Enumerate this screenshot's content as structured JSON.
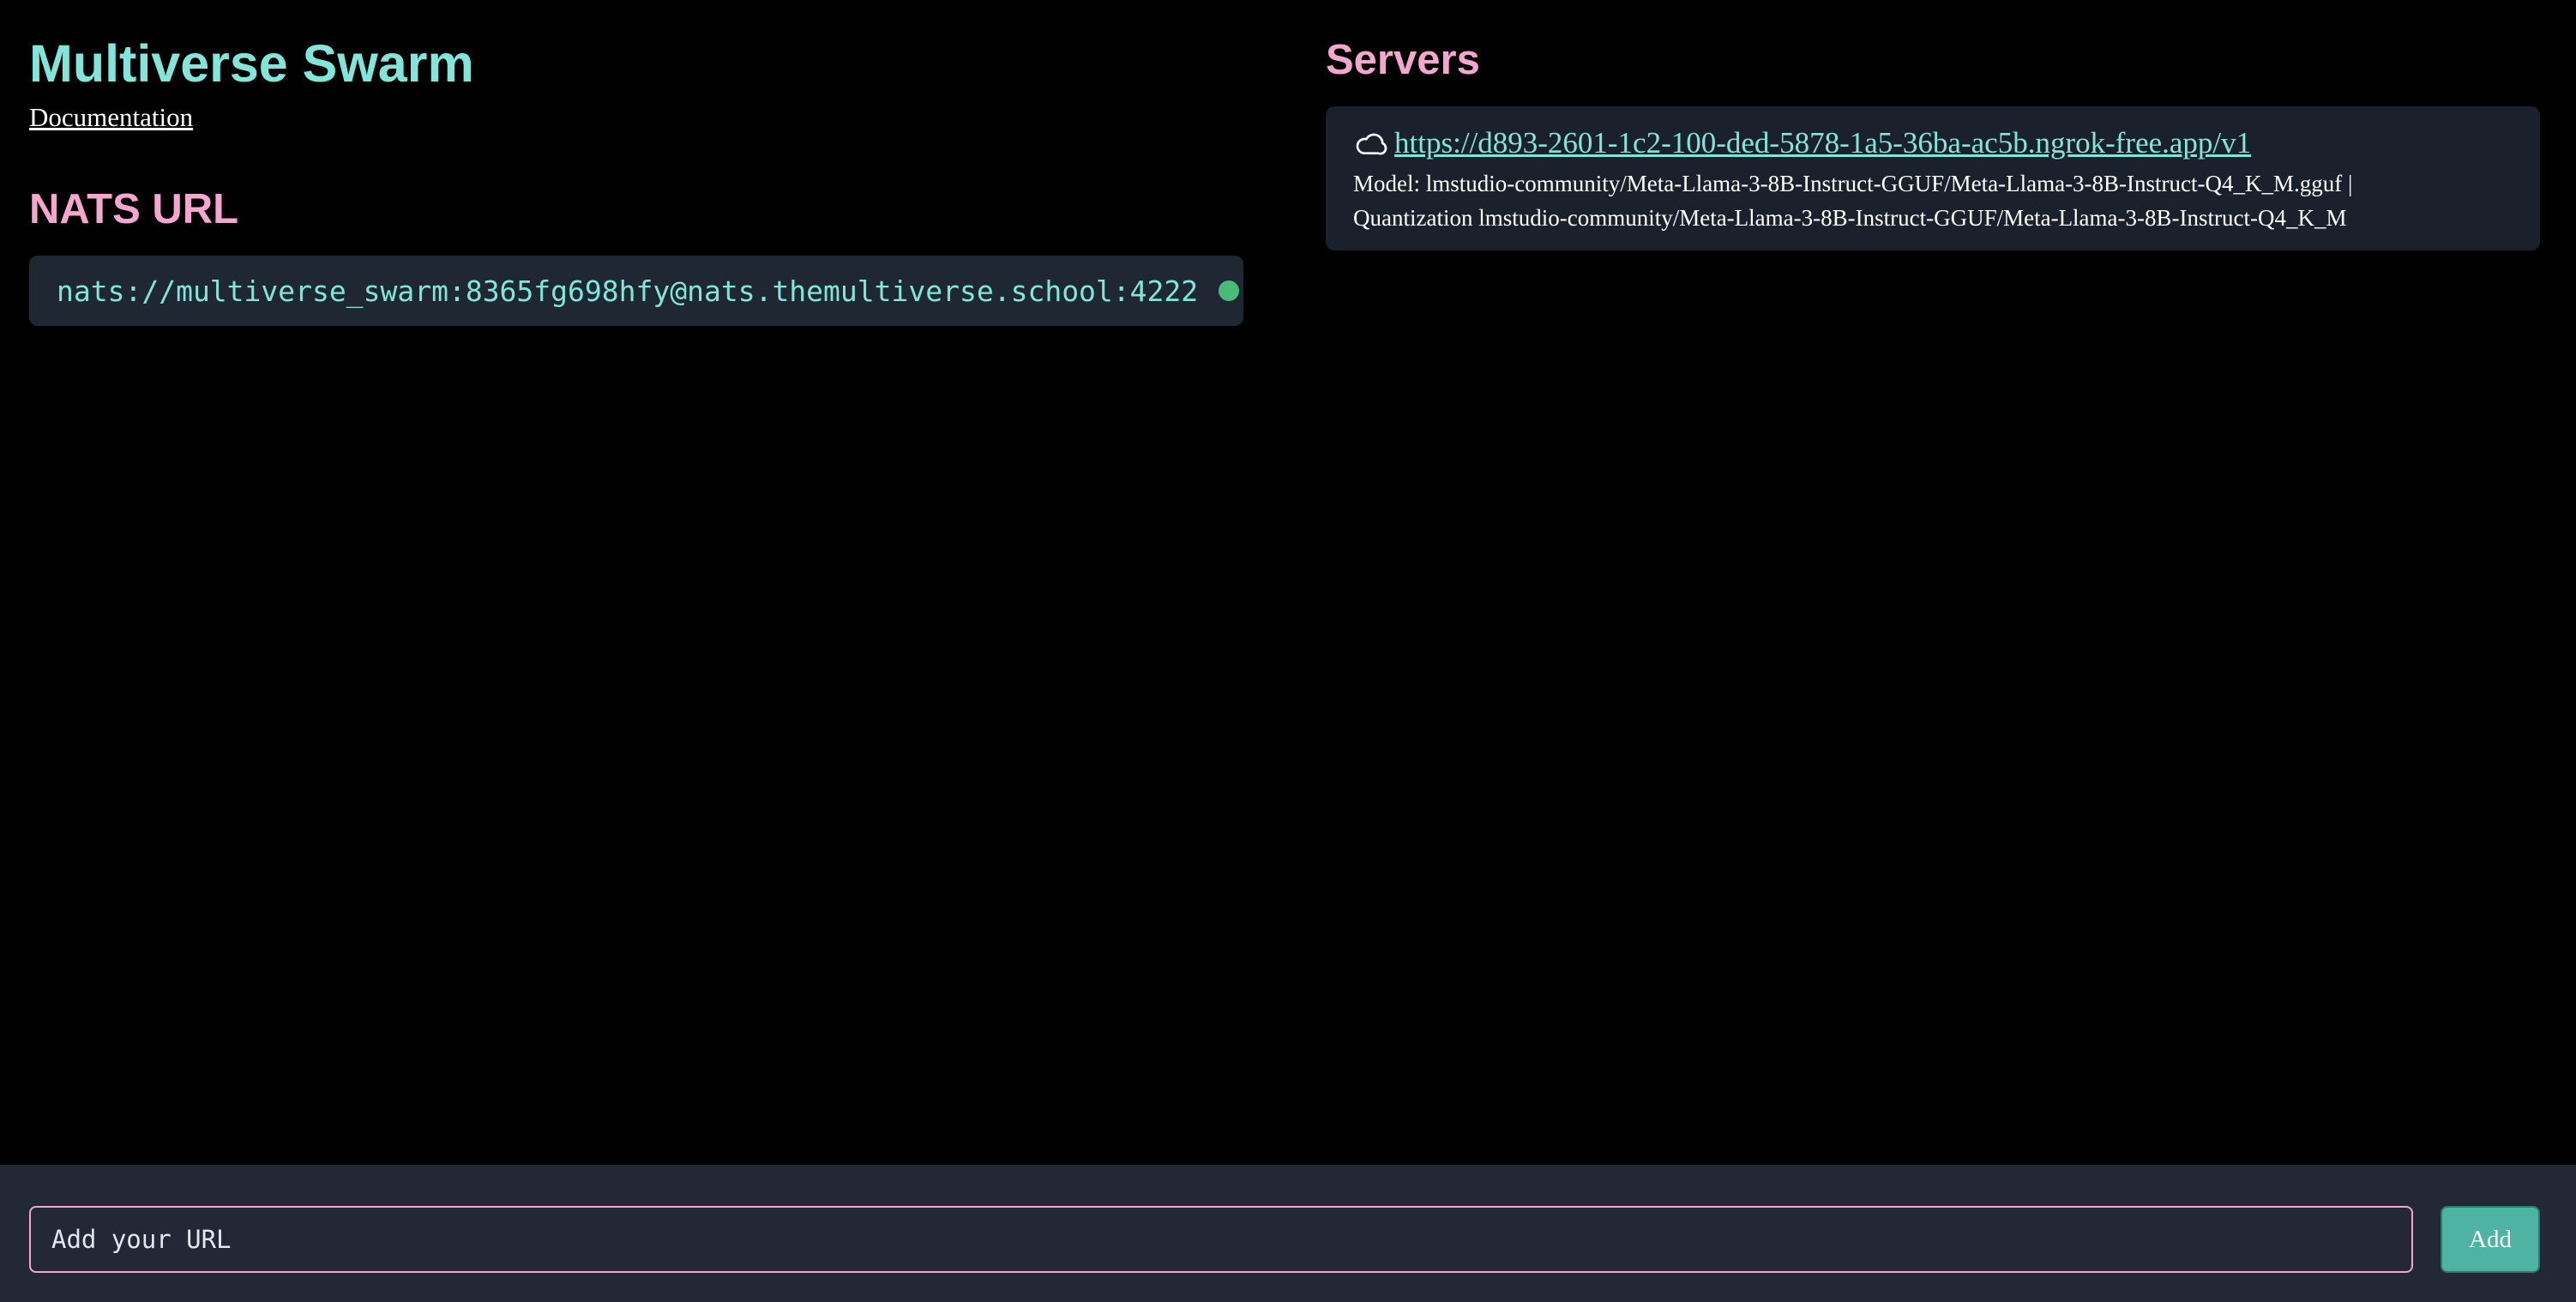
{
  "header": {
    "title": "Multiverse Swarm",
    "documentation_link": "Documentation"
  },
  "nats": {
    "heading": "NATS URL",
    "url": "nats://multiverse_swarm:8365fg698hfy@nats.themultiverse.school:4222",
    "status_color": "#48bb78"
  },
  "servers": {
    "heading": "Servers",
    "items": [
      {
        "icon": "cloud-icon",
        "url": "https://d893-2601-1c2-100-ded-5878-1a5-36ba-ac5b.ngrok-free.app/v1",
        "meta": "Model: lmstudio-community/Meta-Llama-3-8B-Instruct-GGUF/Meta-Llama-3-8B-Instruct-Q4_K_M.gguf | Quantization lmstudio-community/Meta-Llama-3-8B-Instruct-GGUF/Meta-Llama-3-8B-Instruct-Q4_K_M"
      }
    ]
  },
  "footer": {
    "input_placeholder": "Add your URL",
    "input_value": "",
    "add_label": "Add"
  },
  "colors": {
    "accent_teal": "#81e6d9",
    "accent_pink": "#f4a6cf",
    "background": "#000000",
    "panel": "#1f2733",
    "button": "#4fb3a4"
  }
}
